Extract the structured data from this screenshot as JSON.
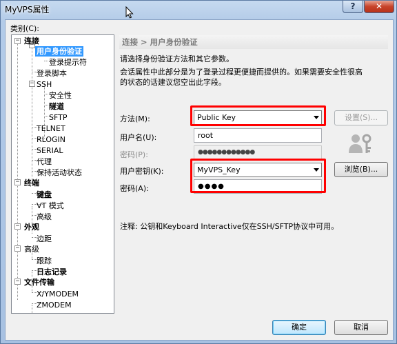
{
  "window": {
    "title": "MyVPS属性"
  },
  "category_label": "类别(C):",
  "tree": {
    "connection": "连接",
    "user_auth": "用户身份验证",
    "login_prompt": "登录提示符",
    "login_script": "登录脚本",
    "ssh": "SSH",
    "security": "安全性",
    "tunnel": "隧道",
    "sftp": "SFTP",
    "telnet": "TELNET",
    "rlogin": "RLOGIN",
    "serial": "SERIAL",
    "proxy": "代理",
    "keepalive": "保持活动状态",
    "terminal": "终端",
    "keyboard": "键盘",
    "vt_mode": "VT 模式",
    "advanced_term": "高级",
    "appearance": "外观",
    "margin": "边距",
    "advanced": "高级",
    "trace": "跟踪",
    "logging": "日志记录",
    "file_transfer": "文件传输",
    "xymodem": "X/YMODEM",
    "zmodem": "ZMODEM"
  },
  "panel": {
    "header": "连接 > 用户身份验证",
    "desc1": "请选择身份验证方法和其它参数。",
    "desc2": "会话属性中此部分是为了登录过程更便捷而提供的。如果需要安全性很高",
    "desc3": "的状态的话建议您空出此字段。",
    "method_label": "方法(M):",
    "method_value": "Public Key",
    "settings_button": "设置(S)...",
    "username_label": "用户名(U):",
    "username_value": "root",
    "password_label_disabled": "密码(P):",
    "password_value_disabled": "●●●●●●●●●●●●",
    "user_key_label": "用户密钥(K):",
    "user_key_value": "MyVPS_Key",
    "browse_button": "浏览(B)...",
    "passphrase_label": "密码(A):",
    "passphrase_value": "●●●●",
    "note": "注释: 公钥和Keyboard Interactive仅在SSH/SFTP协议中可用。"
  },
  "buttons": {
    "ok": "确定",
    "cancel": "取消"
  },
  "colors": {
    "highlight": "#ff0000",
    "selection": "#3399ff"
  }
}
